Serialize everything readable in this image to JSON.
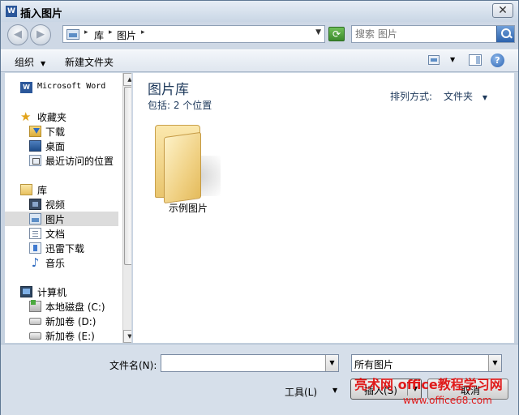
{
  "window": {
    "title": "插入图片",
    "app_icon": "W",
    "close_label": "✕"
  },
  "address_bar": {
    "crumbs": [
      "库",
      "图片"
    ],
    "search_placeholder": "搜索 图片"
  },
  "toolbar": {
    "organize": "组织",
    "new_folder": "新建文件夹",
    "help": "?"
  },
  "sidebar": {
    "items": [
      {
        "label": "Microsoft Word",
        "icon": "word-icon"
      },
      {
        "label": "收藏夹",
        "icon": "star-icon"
      },
      {
        "label": "下载",
        "icon": "download-folder-icon"
      },
      {
        "label": "桌面",
        "icon": "desktop-icon"
      },
      {
        "label": "最近访问的位置",
        "icon": "recent-places-icon"
      },
      {
        "label": "库",
        "icon": "library-icon"
      },
      {
        "label": "视频",
        "icon": "video-icon"
      },
      {
        "label": "图片",
        "icon": "picture-icon"
      },
      {
        "label": "文档",
        "icon": "document-icon"
      },
      {
        "label": "迅雷下载",
        "icon": "thunder-download-icon"
      },
      {
        "label": "音乐",
        "icon": "music-icon"
      },
      {
        "label": "计算机",
        "icon": "computer-icon"
      },
      {
        "label": "本地磁盘 (C:)",
        "icon": "drive-c-icon"
      },
      {
        "label": "新加卷 (D:)",
        "icon": "drive-icon"
      },
      {
        "label": "新加卷 (E:)",
        "icon": "drive-icon"
      }
    ],
    "selected": "图片"
  },
  "main": {
    "library_title": "图片库",
    "includes": "包括: 2 个位置",
    "arrange_label": "排列方式:",
    "arrange_value": "文件夹",
    "folders": [
      {
        "label": "示例图片",
        "icon": "folder-icon"
      }
    ]
  },
  "bottom": {
    "filename_label": "文件名(N):",
    "filename_value": "",
    "filter_value": "所有图片",
    "tools_label": "工具(L)",
    "insert_label": "插入(S)",
    "cancel_label": "取消"
  },
  "watermark": {
    "line1": "亮术网 office教程学习网",
    "line2": "www.office68.com"
  }
}
